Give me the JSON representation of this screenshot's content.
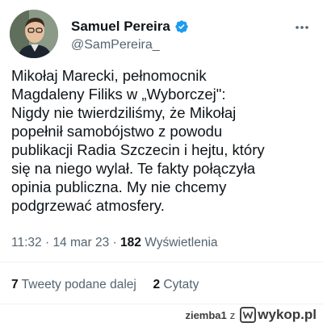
{
  "author": {
    "name": "Samuel Pereira",
    "handle": "@SamPereira_",
    "verified_icon": "verified-badge-icon",
    "badge_color": "#1d9bf0"
  },
  "tweet": {
    "text": "Mikołaj Marecki, pełnomocnik\nMagdaleny Filiks w „Wyborczej\":\nNigdy nie twierdziliśmy, że Mikołaj\npopełnił samobójstwo z powodu\npublikacji Radia Szczecin i hejtu, który\nsię na niego wylał. Te fakty połączyła\nopinia publiczna. My nie chcemy\npodgrzewać atmosfery."
  },
  "meta": {
    "time": "11:32",
    "separator1": "·",
    "date": "14 mar 23",
    "separator2": "·",
    "views_count": "182",
    "views_label": "Wyświetlenia"
  },
  "stats": {
    "retweets_count": "7",
    "retweets_label": "Tweety podane dalej",
    "quotes_count": "2",
    "quotes_label": "Cytaty"
  },
  "watermark": {
    "user": "ziemba1",
    "z": "z",
    "brand": "wykop.pl"
  }
}
